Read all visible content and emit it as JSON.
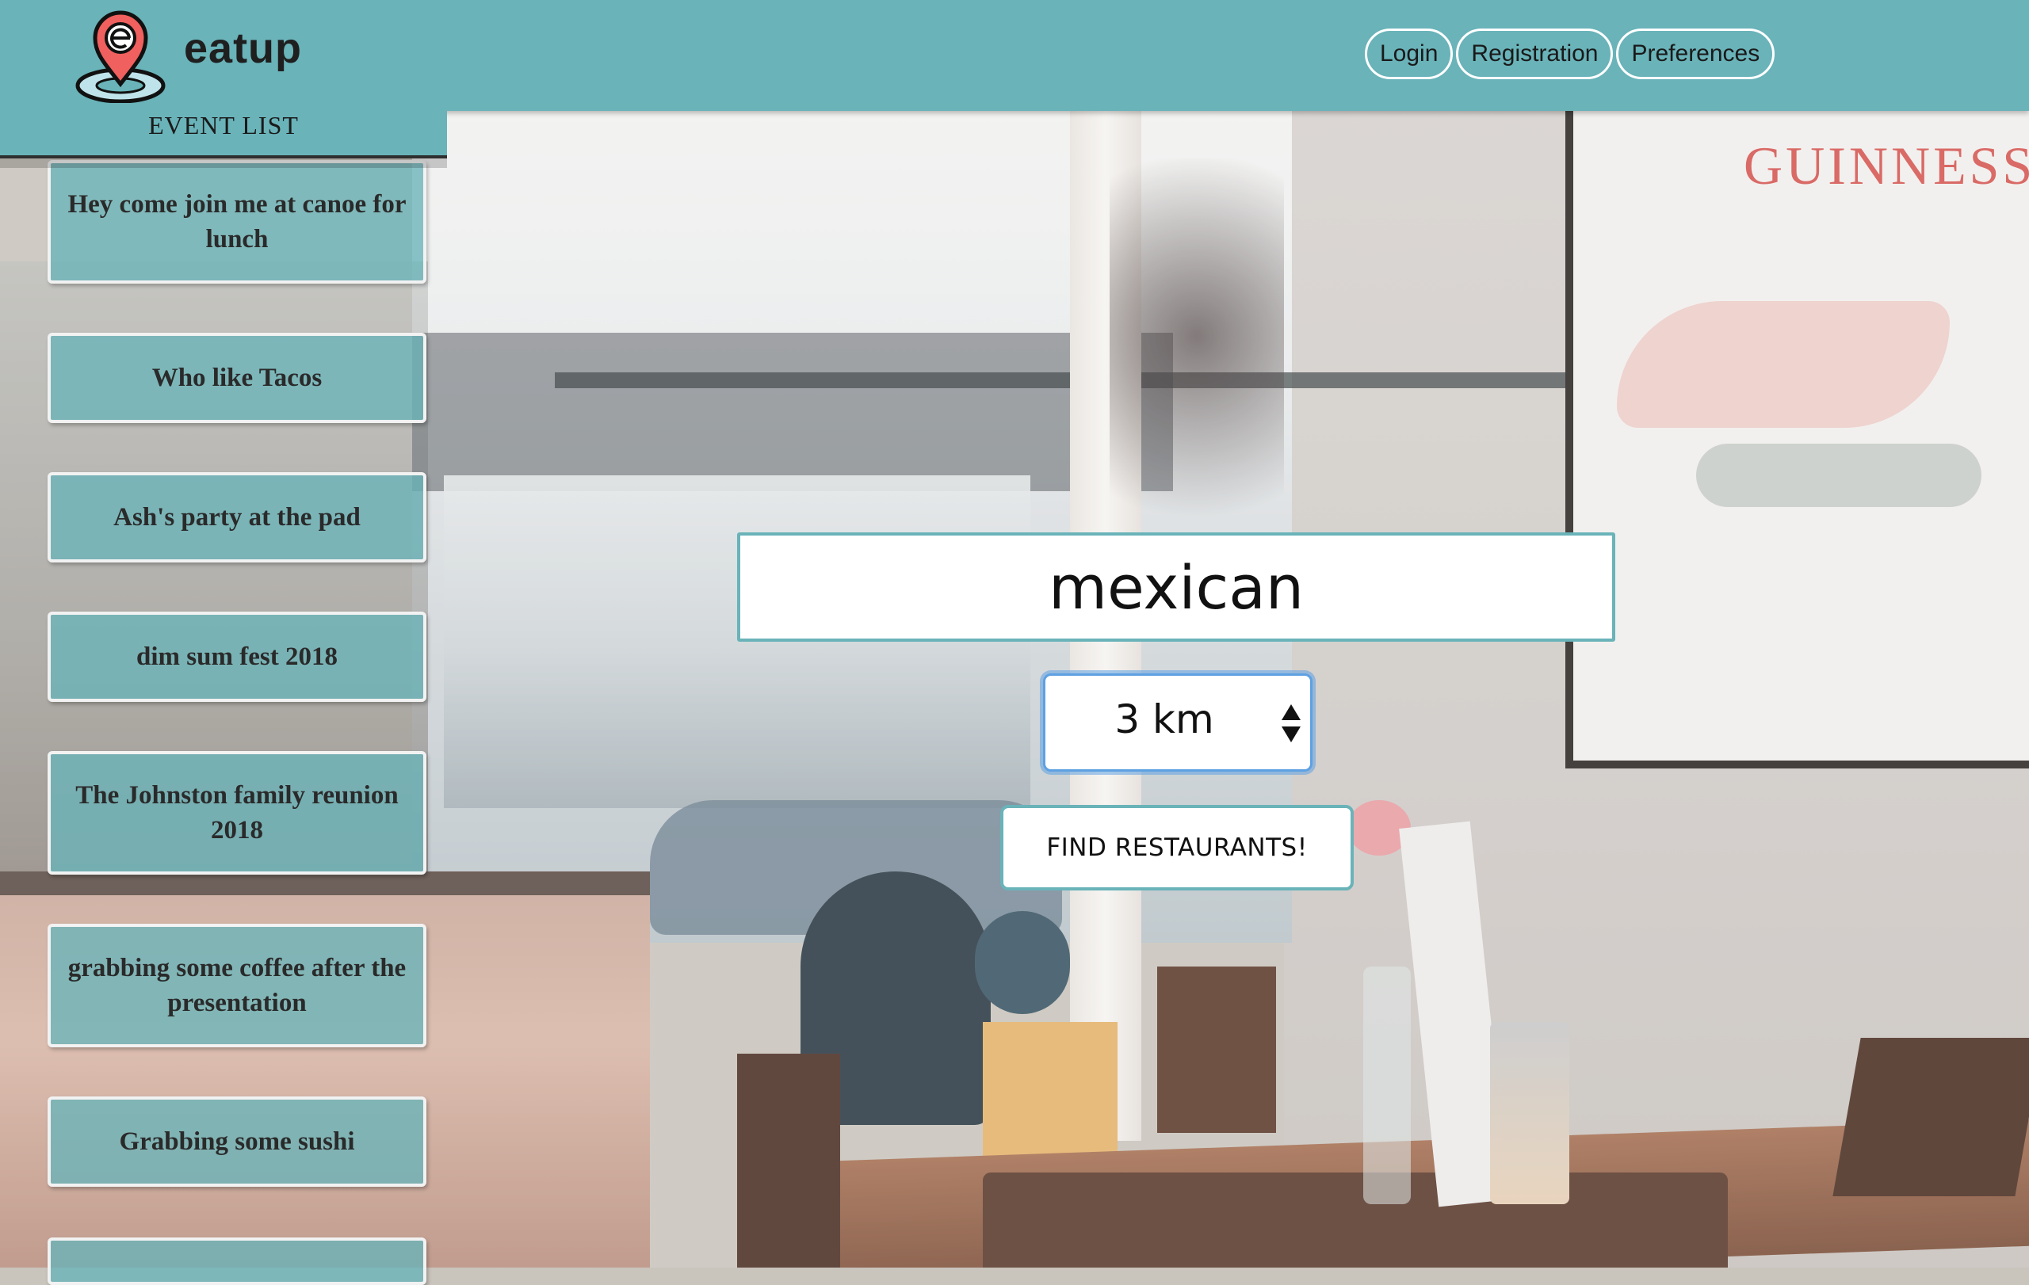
{
  "header": {
    "brand": "eatup",
    "nav": [
      {
        "label": "Login"
      },
      {
        "label": "Registration"
      },
      {
        "label": "Preferences"
      }
    ],
    "color": "#69b3b9"
  },
  "sidebar": {
    "title": "EVENT LIST",
    "events": [
      {
        "label": "Hey come join me at canoe for lunch"
      },
      {
        "label": "Who like Tacos"
      },
      {
        "label": "Ash's party at the pad"
      },
      {
        "label": "dim sum fest 2018"
      },
      {
        "label": "The Johnston family reunion 2018"
      },
      {
        "label": "grabbing some coffee after the presentation"
      },
      {
        "label": "Grabbing some sushi"
      },
      {
        "label": ""
      }
    ]
  },
  "search": {
    "query": "mexican",
    "distance": "3 km",
    "button_label": "FIND RESTAURANTS!"
  },
  "background": {
    "poster_text": "GUINNESS"
  }
}
